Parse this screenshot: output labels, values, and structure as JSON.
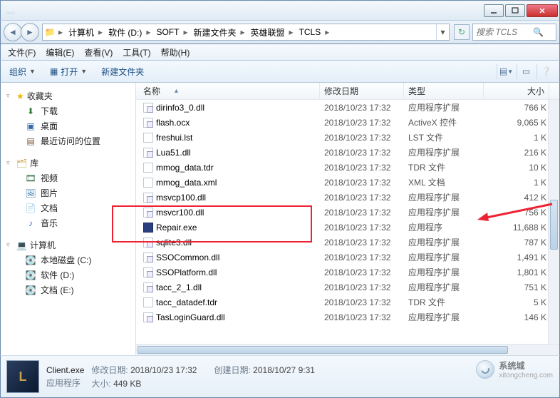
{
  "window": {
    "title": "…"
  },
  "breadcrumb": {
    "segments": [
      "计算机",
      "软件 (D:)",
      "SOFT",
      "新建文件夹",
      "英雄联盟",
      "TCLS"
    ]
  },
  "search": {
    "placeholder": "搜索 TCLS"
  },
  "menu": {
    "file": "文件(F)",
    "edit": "编辑(E)",
    "view": "查看(V)",
    "tools": "工具(T)",
    "help": "帮助(H)"
  },
  "toolbar": {
    "organize": "组织",
    "open": "打开",
    "newfolder": "新建文件夹"
  },
  "navpane": {
    "favorites": {
      "label": "收藏夹",
      "items": [
        "下载",
        "桌面",
        "最近访问的位置"
      ]
    },
    "libraries": {
      "label": "库",
      "items": [
        "视频",
        "图片",
        "文档",
        "音乐"
      ]
    },
    "computer": {
      "label": "计算机",
      "items": [
        "本地磁盘 (C:)",
        "软件 (D:)",
        "文档 (E:)"
      ]
    }
  },
  "columns": {
    "name": "名称",
    "date": "修改日期",
    "type": "类型",
    "size": "大小"
  },
  "files": [
    {
      "icon": "dll",
      "name": "dirinfo3_0.dll",
      "date": "2018/10/23 17:32",
      "type": "应用程序扩展",
      "size": "766 K"
    },
    {
      "icon": "dll",
      "name": "flash.ocx",
      "date": "2018/10/23 17:32",
      "type": "ActiveX 控件",
      "size": "9,065 K"
    },
    {
      "icon": "file",
      "name": "freshui.lst",
      "date": "2018/10/23 17:32",
      "type": "LST 文件",
      "size": "1 K"
    },
    {
      "icon": "dll",
      "name": "Lua51.dll",
      "date": "2018/10/23 17:32",
      "type": "应用程序扩展",
      "size": "216 K"
    },
    {
      "icon": "file",
      "name": "mmog_data.tdr",
      "date": "2018/10/23 17:32",
      "type": "TDR 文件",
      "size": "10 K"
    },
    {
      "icon": "file",
      "name": "mmog_data.xml",
      "date": "2018/10/23 17:32",
      "type": "XML 文档",
      "size": "1 K"
    },
    {
      "icon": "dll",
      "name": "msvcp100.dll",
      "date": "2018/10/23 17:32",
      "type": "应用程序扩展",
      "size": "412 K"
    },
    {
      "icon": "dll",
      "name": "msvcr100.dll",
      "date": "2018/10/23 17:32",
      "type": "应用程序扩展",
      "size": "756 K"
    },
    {
      "icon": "exe",
      "name": "Repair.exe",
      "date": "2018/10/23 17:32",
      "type": "应用程序",
      "size": "11,688 K"
    },
    {
      "icon": "dll",
      "name": "sqlite3.dll",
      "date": "2018/10/23 17:32",
      "type": "应用程序扩展",
      "size": "787 K"
    },
    {
      "icon": "dll",
      "name": "SSOCommon.dll",
      "date": "2018/10/23 17:32",
      "type": "应用程序扩展",
      "size": "1,491 K"
    },
    {
      "icon": "dll",
      "name": "SSOPlatform.dll",
      "date": "2018/10/23 17:32",
      "type": "应用程序扩展",
      "size": "1,801 K"
    },
    {
      "icon": "dll",
      "name": "tacc_2_1.dll",
      "date": "2018/10/23 17:32",
      "type": "应用程序扩展",
      "size": "751 K"
    },
    {
      "icon": "file",
      "name": "tacc_datadef.tdr",
      "date": "2018/10/23 17:32",
      "type": "TDR 文件",
      "size": "5 K"
    },
    {
      "icon": "dll",
      "name": "TasLoginGuard.dll",
      "date": "2018/10/23 17:32",
      "type": "应用程序扩展",
      "size": "146 K"
    }
  ],
  "details": {
    "filename": "Client.exe",
    "filetype": "应用程序",
    "mod_label": "修改日期:",
    "mod_value": "2018/10/23 17:32",
    "create_label": "创建日期:",
    "create_value": "2018/10/27 9:31",
    "size_label": "大小:",
    "size_value": "449 KB"
  },
  "watermark": {
    "brand": "系统城",
    "url": "xitongcheng.com"
  },
  "highlight": {
    "arrow_color": "#e23"
  }
}
